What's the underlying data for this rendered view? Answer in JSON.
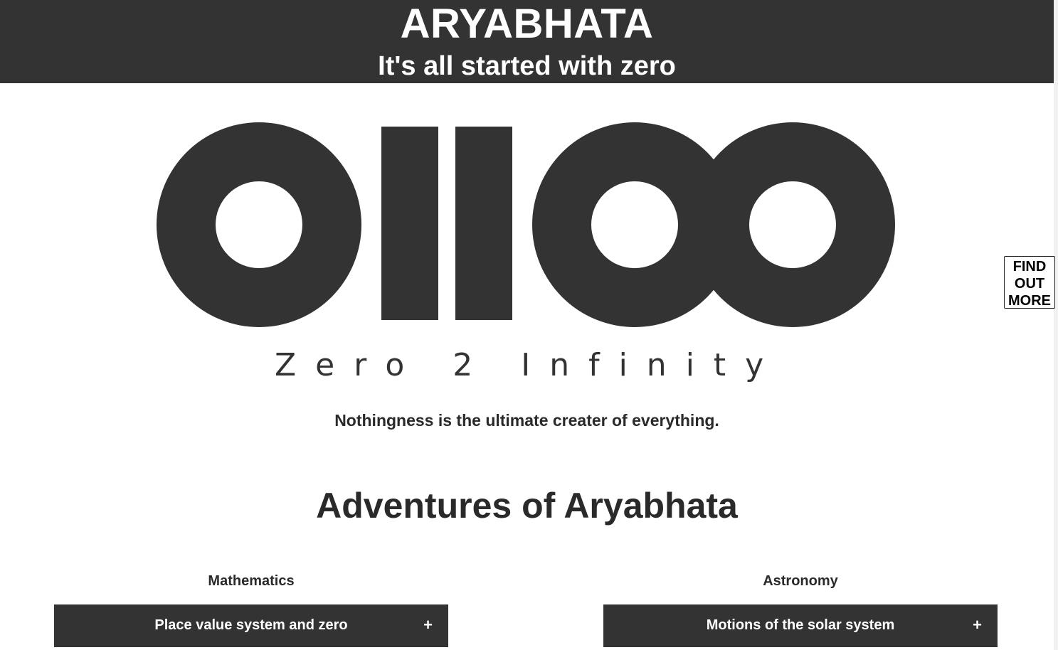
{
  "header": {
    "title": "ARYABHATA",
    "subtitle": "It's all started with zero"
  },
  "logo": {
    "icon": "zero-to-infinity-logo-icon",
    "tagline": "Zero 2 Infinity",
    "color": "#333333"
  },
  "quote": "Nothingness is the ultimate creater of everything.",
  "section": {
    "title": "Adventures of Aryabhata"
  },
  "columns": [
    {
      "heading": "Mathematics",
      "accordion_label": "Place value system and zero",
      "toggle": "+"
    },
    {
      "heading": "Astronomy",
      "accordion_label": "Motions of the solar system",
      "toggle": "+"
    }
  ],
  "find_more": {
    "line1": "FIND",
    "line2": "OUT",
    "line3": "MORE"
  },
  "colors": {
    "header_bg": "#333333",
    "header_text": "#ffffff",
    "accordion_bg": "#333333"
  }
}
